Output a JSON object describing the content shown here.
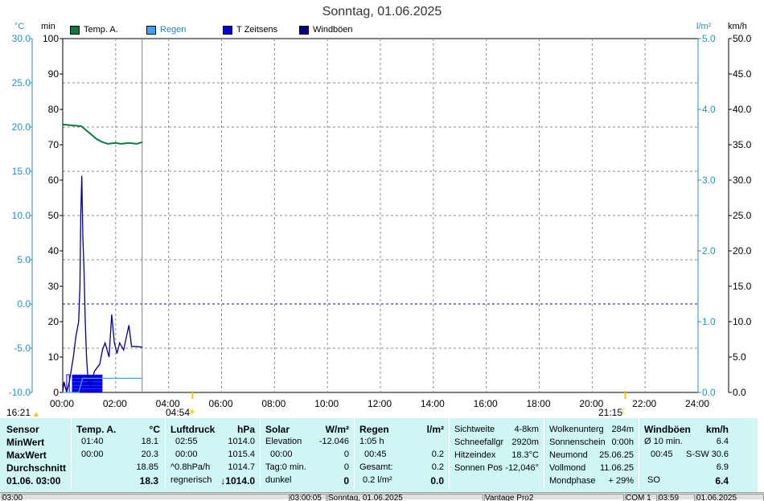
{
  "title": "Sonntag, 01.06.2025",
  "units": {
    "celsius": "°C",
    "min": "min",
    "lm2": "l/m²",
    "kmh": "km/h"
  },
  "legend": [
    {
      "label": "Temp. A.",
      "color": "#0a7a3a",
      "text_color": "#000000"
    },
    {
      "label": "Regen",
      "color": "#3fa0ff",
      "text_color": "#2b7fb8"
    },
    {
      "label": "T Zeitsens",
      "color": "#0000e0",
      "text_color": "#000000"
    },
    {
      "label": "Windböen",
      "color": "#00008b",
      "text_color": "#000000"
    }
  ],
  "axes": {
    "celsius_ticks": [
      "30.0",
      "25.0",
      "20.0",
      "15.0",
      "10.0",
      "5.0",
      "0.0",
      "-5.0",
      "-10.0"
    ],
    "min_ticks": [
      "100",
      "90",
      "80",
      "70",
      "60",
      "50",
      "40",
      "30",
      "20",
      "10",
      "0"
    ],
    "lm2_ticks": [
      "5.0",
      "4.0",
      "3.0",
      "2.0",
      "1.0",
      "0.0"
    ],
    "kmh_ticks": [
      "50.0",
      "45.0",
      "40.0",
      "35.0",
      "30.0",
      "25.0",
      "20.0",
      "15.0",
      "10.0",
      "5.0",
      "0.0"
    ],
    "x_ticks": [
      "00:00",
      "02:00",
      "04:00",
      "06:00",
      "08:00",
      "10:00",
      "12:00",
      "14:00",
      "16:00",
      "18:00",
      "20:00",
      "22:00",
      "24:00"
    ],
    "x_range_hours": [
      0,
      24
    ],
    "celsius_range": [
      -10,
      30
    ],
    "min_range": [
      0,
      100
    ],
    "lm2_range": [
      0,
      5
    ],
    "kmh_range": [
      0,
      50
    ]
  },
  "markers": {
    "sunrise_prev": "16:21",
    "sunrise": "04:54",
    "sunset": "21:15",
    "sunrise_hours": 4.9,
    "sunset_hours": 21.25,
    "current_hours": 3.0
  },
  "chart_data": {
    "type": "line",
    "title": "Sonntag, 01.06.2025",
    "x_unit": "hours",
    "series": [
      {
        "name": "Temp. A.",
        "axis": "celsius",
        "points": [
          [
            0,
            20.3
          ],
          [
            0.3,
            20.2
          ],
          [
            0.7,
            20.1
          ],
          [
            0.9,
            19.6
          ],
          [
            1.1,
            19.1
          ],
          [
            1.3,
            18.6
          ],
          [
            1.5,
            18.3
          ],
          [
            1.7,
            18.1
          ],
          [
            2.0,
            18.2
          ],
          [
            2.2,
            18.1
          ],
          [
            2.5,
            18.2
          ],
          [
            2.8,
            18.1
          ],
          [
            3.0,
            18.3
          ]
        ]
      },
      {
        "name": "Windböen",
        "axis": "kmh",
        "points": [
          [
            0,
            0
          ],
          [
            0.05,
            1.5
          ],
          [
            0.15,
            0
          ],
          [
            0.25,
            1.5
          ],
          [
            0.4,
            5
          ],
          [
            0.5,
            8
          ],
          [
            0.6,
            10
          ],
          [
            0.65,
            15
          ],
          [
            0.68,
            25
          ],
          [
            0.72,
            30.6
          ],
          [
            0.76,
            22
          ],
          [
            0.8,
            18
          ],
          [
            0.85,
            10
          ],
          [
            0.9,
            5
          ],
          [
            0.95,
            2
          ],
          [
            1.05,
            1
          ],
          [
            1.2,
            3
          ],
          [
            1.4,
            4
          ],
          [
            1.5,
            6
          ],
          [
            1.6,
            7
          ],
          [
            1.75,
            5
          ],
          [
            1.85,
            11
          ],
          [
            1.95,
            7
          ],
          [
            2.05,
            5.5
          ],
          [
            2.15,
            7
          ],
          [
            2.3,
            6
          ],
          [
            2.5,
            9.5
          ],
          [
            2.6,
            6.5
          ],
          [
            2.75,
            6.5
          ],
          [
            3.0,
            6.4
          ]
        ]
      },
      {
        "name": "T Zeitsens",
        "axis": "min",
        "points": [
          [
            0.15,
            0
          ],
          [
            0.15,
            5
          ],
          [
            0.35,
            5
          ],
          [
            0.35,
            0
          ],
          [
            0.4,
            5
          ],
          [
            1.5,
            5
          ]
        ]
      },
      {
        "name": "Regen",
        "axis": "lm2",
        "points": [
          [
            0,
            0
          ],
          [
            0.6,
            0
          ],
          [
            0.75,
            0.2
          ],
          [
            3.0,
            0.2
          ]
        ]
      }
    ]
  },
  "panel": {
    "sensor": {
      "header": "Sensor",
      "min": "MinWert",
      "max": "MaxWert",
      "avg": "Durchschnitt",
      "date": "01.06. 03:00"
    },
    "temp": {
      "header": "Temp. A.",
      "unit": "°C",
      "min_time": "01:40",
      "min_val": "18.1",
      "max_time": "00:00",
      "max_val": "20.3",
      "avg": "18.85",
      "cur": "18.3"
    },
    "pressure": {
      "header": "Luftdruck",
      "unit": "hPa",
      "min_time": "02:55",
      "min_val": "1014.0",
      "max_time": "00:00",
      "max_val": "1015.4",
      "trend": "^0.8hPa/h",
      "avg": "1014.7",
      "weather": "regnerisch",
      "cur": "↓1014.0"
    },
    "solar": {
      "header": "Solar",
      "unit": "W/m²",
      "elev_label": "Elevation",
      "elev_val": "-12.046",
      "max_time": "00:00",
      "max_val": "0",
      "tag_label": "Tag:0 min.",
      "tag_val": "0",
      "state": "dunkel",
      "cur": "0"
    },
    "rain": {
      "header": "Regen",
      "unit": "l/m²",
      "dur": "1:05 h",
      "time": "00:45",
      "time_val": "0.2",
      "total_label": "Gesamt:",
      "total_val": "0.2",
      "rate": "0.2 l/m²",
      "cur": "0.0"
    },
    "misc": {
      "vis_label": "Sichtweite",
      "vis_val": "4-8km",
      "snow_label": "Schneefallgr",
      "snow_val": "2920m",
      "heat_label": "Hitzeindex",
      "heat_val": "18.3°C",
      "sunpos_label": "Sonnen Pos",
      "sunpos_val": "-12,046°"
    },
    "sky": {
      "cloud_label": "Wolkenunterg",
      "cloud_val": "284m",
      "sun_label": "Sonnenschein",
      "sun_val": "0:00h",
      "new_label": "Neumond",
      "new_val": "25.06.25",
      "full_label": "Vollmond",
      "full_val": "11.06.25",
      "phase_label": "Mondphase",
      "phase_val": "+ 29%"
    },
    "wind": {
      "header": "Windböen",
      "unit": "km/h",
      "avg10_label": "Ø 10 min.",
      "avg10_val": "6.4",
      "max_time": "00:45",
      "max_dir": "S-SW",
      "max_val": "30.6",
      "avg": "6.9",
      "dir": "SO",
      "cur": "6.4"
    }
  },
  "statusbar": [
    "03:00",
    "03:00:05",
    "Sonntag, 01.06.2025",
    "Vantage Pro2",
    "COM 1",
    "03:59",
    "01.06.2025"
  ]
}
